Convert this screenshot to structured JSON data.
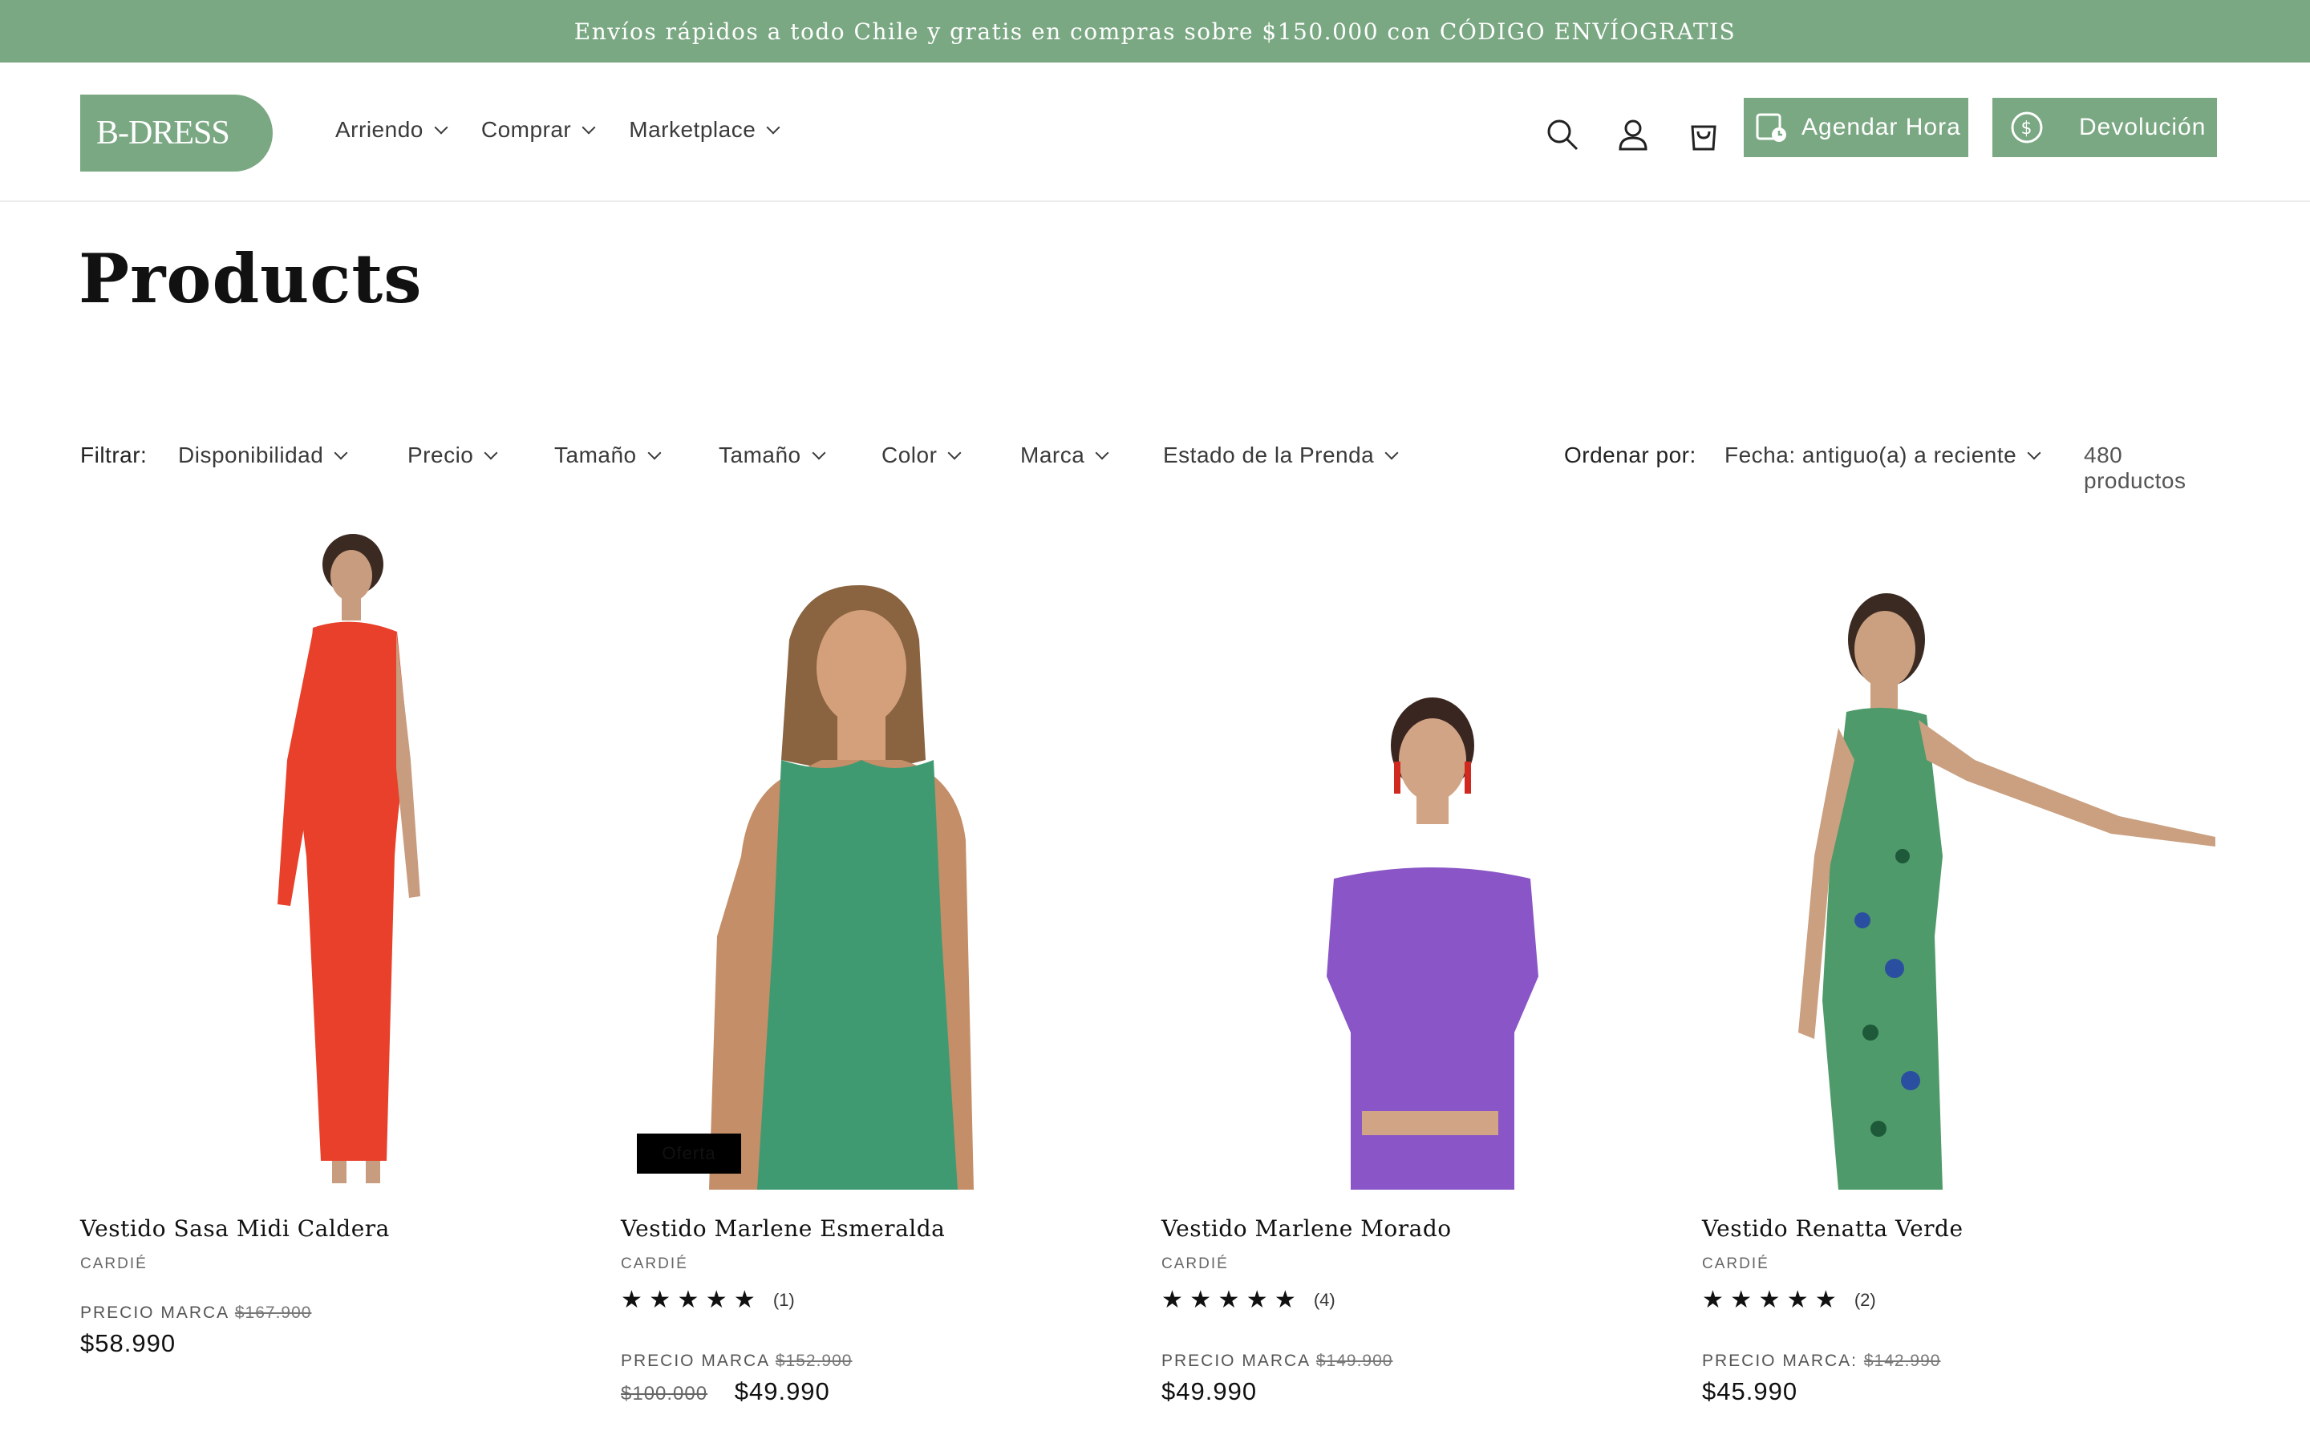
{
  "announcement": "Envíos rápidos a todo Chile y gratis en compras sobre $150.000 con CÓDIGO ENVÍOGRATIS",
  "logo": "B-DRESS",
  "nav": [
    {
      "label": "Arriendo"
    },
    {
      "label": "Comprar"
    },
    {
      "label": "Marketplace"
    }
  ],
  "header_icons": {
    "search": "search-icon",
    "account": "user-icon",
    "cart": "bag-icon"
  },
  "buttons": {
    "schedule": "Agendar Hora",
    "returns": "Devolución"
  },
  "page_title": "Products",
  "filters": {
    "label": "Filtrar:",
    "items": [
      "Disponibilidad",
      "Precio",
      "Tamaño",
      "Tamaño",
      "Color",
      "Marca",
      "Estado de la Prenda"
    ],
    "sort_label": "Ordenar por:",
    "sort_value": "Fecha: antiguo(a) a reciente",
    "count": "480 productos"
  },
  "colors": {
    "brand_green": "#7aa882"
  },
  "products": [
    {
      "name": "Vestido Sasa Midi Caldera",
      "brand": "CARDIÉ",
      "price_label": "PRECIO MARCA",
      "brand_price": "$167.900",
      "price": "$58.990",
      "dress_color": "#e8402a"
    },
    {
      "name": "Vestido Marlene Esmeralda",
      "brand": "CARDIÉ",
      "rating": "★ ★ ★ ★ ★",
      "review_count": "(1)",
      "price_label": "PRECIO MARCA",
      "brand_price": "$152.900",
      "compare_price": "$100.000",
      "price": "$49.990",
      "badge": "Oferta",
      "dress_color": "#3f9a72"
    },
    {
      "name": "Vestido Marlene Morado",
      "brand": "CARDIÉ",
      "rating": "★ ★ ★ ★ ★",
      "review_count": "(4)",
      "price_label": "PRECIO MARCA",
      "brand_price": "$149.900",
      "price": "$49.990",
      "dress_color": "#8a55c6"
    },
    {
      "name": "Vestido Renatta Verde",
      "brand": "CARDIÉ",
      "rating": "★ ★ ★ ★ ★",
      "review_count": "(2)",
      "price_label": "PRECIO MARCA:",
      "brand_price": "$142.990",
      "price": "$45.990",
      "dress_color": "#4f9a6a"
    }
  ]
}
